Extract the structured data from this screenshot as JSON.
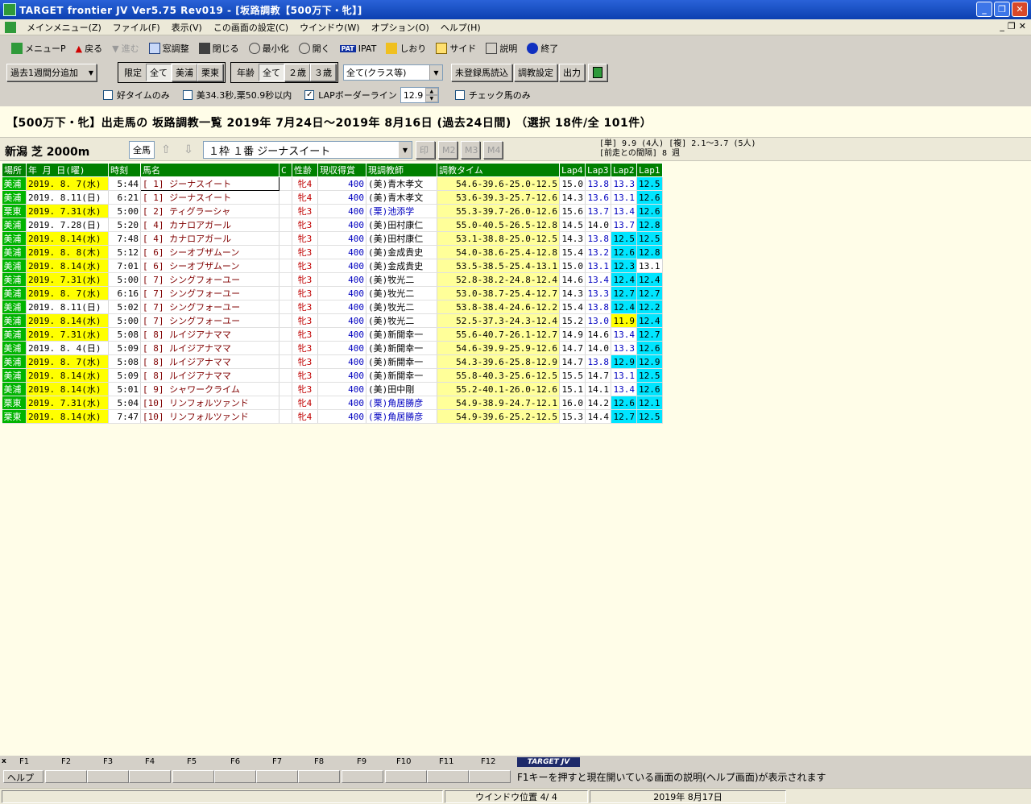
{
  "window": {
    "title": "TARGET frontier JV  Ver5.75  Rev019 - [坂路調教【500万下・牝】]"
  },
  "menu": [
    "メインメニュー(Z)",
    "ファイル(F)",
    "表示(V)",
    "この画面の設定(C)",
    "ウインドウ(W)",
    "オプション(O)",
    "ヘルプ(H)"
  ],
  "toolbar1": [
    {
      "label": "メニューP",
      "icon": "menu-icon"
    },
    {
      "label": "戻る",
      "icon": "back-arrow-icon"
    },
    {
      "label": "進む",
      "icon": "forward-arrow-icon",
      "disabled": true
    },
    {
      "label": "窓調整",
      "icon": "window-icon"
    },
    {
      "label": "閉じる",
      "icon": "close-door-icon"
    },
    {
      "label": "最小化",
      "icon": "minimize-icon"
    },
    {
      "label": "開く",
      "icon": "open-icon"
    },
    {
      "label": "IPAT",
      "icon": "pat-icon"
    },
    {
      "label": "しおり",
      "icon": "bookmark-icon"
    },
    {
      "label": "サイド",
      "icon": "side-icon"
    },
    {
      "label": "説明",
      "icon": "help-icon"
    },
    {
      "label": "終了",
      "icon": "exit-icon"
    }
  ],
  "toolbar2": {
    "add_week": "過去1週間分追加",
    "limit_label": "限定",
    "limit_opts": [
      "全て",
      "美浦",
      "栗東"
    ],
    "age_label": "年齢",
    "age_opts": [
      "全て",
      "２歳",
      "３歳"
    ],
    "class_select": "全て(クラス等)",
    "btn_unreg": "未登録馬読込",
    "btn_setting": "調教設定",
    "btn_output": "出力"
  },
  "toolbar3": {
    "good_time": "好タイムのみ",
    "time_limit": "美34.3秒,栗50.9秒以内",
    "lap_border": "LAPボーダーライン",
    "lap_value": "12.9",
    "check_only": "チェック馬のみ"
  },
  "heading": "【500万下・牝】出走馬の 坂路調教一覧  2019年 7月24日～2019年 8月16日 (過去24日間) （選択 18件/全 101件）",
  "race": {
    "name": "新潟 芝 2000m",
    "all": "全馬",
    "horse_select": "１枠  １番  ジーナスイート",
    "mark_buttons": [
      "印",
      "M2",
      "M3",
      "M4"
    ],
    "odds_line1": "[単]   9.9 (4人) [複] 2.1～3.7 (5人)",
    "odds_line2": "[前走との間隔] 8 週"
  },
  "table": {
    "headers": [
      "場所",
      "年  月 日(曜)",
      "時刻",
      "馬名",
      "C",
      "性齢",
      "現収得賞",
      "現調教師",
      "調教タイム",
      "Lap4",
      "Lap3",
      "Lap2",
      "Lap1"
    ],
    "rows": [
      {
        "place": "美浦",
        "date": "2019. 8. 7(水)",
        "date_hl": true,
        "time": "5:44",
        "horse": "[ 1]  ジーナスイート",
        "sel": true,
        "sex": "牝4",
        "prize": "400",
        "trainer": "(美)青木孝文",
        "ritto": false,
        "train": "54.6-39.6-25.0-12.5",
        "lap4": "15.0",
        "lap3": "13.8",
        "lap2": "13.3",
        "lap1": "12.5",
        "lap2c": "",
        "lap1c": "cyan",
        "lap3b": true,
        "lap2b": true
      },
      {
        "place": "美浦",
        "date": "2019. 8.11(日)",
        "date_hl": false,
        "time": "6:21",
        "horse": "[ 1]  ジーナスイート",
        "sel": false,
        "sex": "牝4",
        "prize": "400",
        "trainer": "(美)青木孝文",
        "ritto": false,
        "train": "53.6-39.3-25.7-12.6",
        "lap4": "14.3",
        "lap3": "13.6",
        "lap2": "13.1",
        "lap1": "12.6",
        "lap2c": "",
        "lap1c": "cyan",
        "lap3b": true,
        "lap2b": true
      },
      {
        "place": "栗東",
        "date": "2019. 7.31(水)",
        "date_hl": true,
        "time": "5:00",
        "horse": "[ 2]  ティグラーシャ",
        "sel": false,
        "sex": "牝3",
        "prize": "400",
        "trainer": "(栗)池添学",
        "ritto": true,
        "train": "55.3-39.7-26.0-12.6",
        "lap4": "15.6",
        "lap3": "13.7",
        "lap2": "13.4",
        "lap1": "12.6",
        "lap2c": "",
        "lap1c": "cyan",
        "lap3b": true,
        "lap2b": true
      },
      {
        "place": "美浦",
        "date": "2019. 7.28(日)",
        "date_hl": false,
        "time": "5:20",
        "horse": "[ 4]  カナロアガール",
        "sel": false,
        "sex": "牝3",
        "prize": "400",
        "trainer": "(美)田村康仁",
        "ritto": false,
        "train": "55.0-40.5-26.5-12.8",
        "lap4": "14.5",
        "lap3": "14.0",
        "lap2": "13.7",
        "lap1": "12.8",
        "lap2c": "",
        "lap1c": "cyan",
        "lap3b": false,
        "lap2b": true
      },
      {
        "place": "美浦",
        "date": "2019. 8.14(水)",
        "date_hl": true,
        "time": "7:48",
        "horse": "[ 4]  カナロアガール",
        "sel": false,
        "sex": "牝3",
        "prize": "400",
        "trainer": "(美)田村康仁",
        "ritto": false,
        "train": "53.1-38.8-25.0-12.5",
        "lap4": "14.3",
        "lap3": "13.8",
        "lap2": "12.5",
        "lap1": "12.5",
        "lap2c": "cyan",
        "lap1c": "cyan",
        "lap3b": true,
        "lap2b": false
      },
      {
        "place": "美浦",
        "date": "2019. 8. 8(木)",
        "date_hl": true,
        "time": "5:12",
        "horse": "[ 6]  シーオブザムーン",
        "sel": false,
        "sex": "牝3",
        "prize": "400",
        "trainer": "(美)金成貴史",
        "ritto": false,
        "train": "54.0-38.6-25.4-12.8",
        "lap4": "15.4",
        "lap3": "13.2",
        "lap2": "12.6",
        "lap1": "12.8",
        "lap2c": "cyan",
        "lap1c": "cyan",
        "lap3b": true,
        "lap2b": false
      },
      {
        "place": "美浦",
        "date": "2019. 8.14(水)",
        "date_hl": true,
        "time": "7:01",
        "horse": "[ 6]  シーオブザムーン",
        "sel": false,
        "sex": "牝3",
        "prize": "400",
        "trainer": "(美)金成貴史",
        "ritto": false,
        "train": "53.5-38.5-25.4-13.1",
        "lap4": "15.0",
        "lap3": "13.1",
        "lap2": "12.3",
        "lap1": "13.1",
        "lap2c": "cyan",
        "lap1c": "",
        "lap3b": true,
        "lap2b": false
      },
      {
        "place": "美浦",
        "date": "2019. 7.31(水)",
        "date_hl": true,
        "time": "5:00",
        "horse": "[ 7]  シングフォーユー",
        "sel": false,
        "sex": "牝3",
        "prize": "400",
        "trainer": "(美)牧光二",
        "ritto": false,
        "train": "52.8-38.2-24.8-12.4",
        "lap4": "14.6",
        "lap3": "13.4",
        "lap2": "12.4",
        "lap1": "12.4",
        "lap2c": "cyan",
        "lap1c": "cyan",
        "lap3b": true,
        "lap2b": false
      },
      {
        "place": "美浦",
        "date": "2019. 8. 7(水)",
        "date_hl": true,
        "time": "6:16",
        "horse": "[ 7]  シングフォーユー",
        "sel": false,
        "sex": "牝3",
        "prize": "400",
        "trainer": "(美)牧光二",
        "ritto": false,
        "train": "53.0-38.7-25.4-12.7",
        "lap4": "14.3",
        "lap3": "13.3",
        "lap2": "12.7",
        "lap1": "12.7",
        "lap2c": "cyan",
        "lap1c": "cyan",
        "lap3b": true,
        "lap2b": false
      },
      {
        "place": "美浦",
        "date": "2019. 8.11(日)",
        "date_hl": false,
        "time": "5:02",
        "horse": "[ 7]  シングフォーユー",
        "sel": false,
        "sex": "牝3",
        "prize": "400",
        "trainer": "(美)牧光二",
        "ritto": false,
        "train": "53.8-38.4-24.6-12.2",
        "lap4": "15.4",
        "lap3": "13.8",
        "lap2": "12.4",
        "lap1": "12.2",
        "lap2c": "cyan",
        "lap1c": "cyan",
        "lap3b": true,
        "lap2b": false
      },
      {
        "place": "美浦",
        "date": "2019. 8.14(水)",
        "date_hl": true,
        "time": "5:00",
        "horse": "[ 7]  シングフォーユー",
        "sel": false,
        "sex": "牝3",
        "prize": "400",
        "trainer": "(美)牧光二",
        "ritto": false,
        "train": "52.5-37.3-24.3-12.4",
        "lap4": "15.2",
        "lap3": "13.0",
        "lap2": "11.9",
        "lap1": "12.4",
        "lap2c": "yel",
        "lap1c": "cyan",
        "lap3b": true,
        "lap2b": false
      },
      {
        "place": "美浦",
        "date": "2019. 7.31(水)",
        "date_hl": true,
        "time": "5:08",
        "horse": "[ 8]  ルイジアナママ",
        "sel": false,
        "sex": "牝3",
        "prize": "400",
        "trainer": "(美)新開幸一",
        "ritto": false,
        "train": "55.6-40.7-26.1-12.7",
        "lap4": "14.9",
        "lap3": "14.6",
        "lap2": "13.4",
        "lap1": "12.7",
        "lap2c": "",
        "lap1c": "cyan",
        "lap3b": false,
        "lap2b": true
      },
      {
        "place": "美浦",
        "date": "2019. 8. 4(日)",
        "date_hl": false,
        "time": "5:09",
        "horse": "[ 8]  ルイジアナママ",
        "sel": false,
        "sex": "牝3",
        "prize": "400",
        "trainer": "(美)新開幸一",
        "ritto": false,
        "train": "54.6-39.9-25.9-12.6",
        "lap4": "14.7",
        "lap3": "14.0",
        "lap2": "13.3",
        "lap1": "12.6",
        "lap2c": "",
        "lap1c": "cyan",
        "lap3b": false,
        "lap2b": true
      },
      {
        "place": "美浦",
        "date": "2019. 8. 7(水)",
        "date_hl": true,
        "time": "5:08",
        "horse": "[ 8]  ルイジアナママ",
        "sel": false,
        "sex": "牝3",
        "prize": "400",
        "trainer": "(美)新開幸一",
        "ritto": false,
        "train": "54.3-39.6-25.8-12.9",
        "lap4": "14.7",
        "lap3": "13.8",
        "lap2": "12.9",
        "lap1": "12.9",
        "lap2c": "cyan",
        "lap1c": "cyan",
        "lap3b": true,
        "lap2b": false
      },
      {
        "place": "美浦",
        "date": "2019. 8.14(水)",
        "date_hl": true,
        "time": "5:09",
        "horse": "[ 8]  ルイジアナママ",
        "sel": false,
        "sex": "牝3",
        "prize": "400",
        "trainer": "(美)新開幸一",
        "ritto": false,
        "train": "55.8-40.3-25.6-12.5",
        "lap4": "15.5",
        "lap3": "14.7",
        "lap2": "13.1",
        "lap1": "12.5",
        "lap2c": "",
        "lap1c": "cyan",
        "lap3b": false,
        "lap2b": true
      },
      {
        "place": "美浦",
        "date": "2019. 8.14(水)",
        "date_hl": true,
        "time": "5:01",
        "horse": "[ 9]  シャワークライム",
        "sel": false,
        "sex": "牝3",
        "prize": "400",
        "trainer": "(美)田中剛",
        "ritto": false,
        "train": "55.2-40.1-26.0-12.6",
        "lap4": "15.1",
        "lap3": "14.1",
        "lap2": "13.4",
        "lap1": "12.6",
        "lap2c": "",
        "lap1c": "cyan",
        "lap3b": false,
        "lap2b": true
      },
      {
        "place": "栗東",
        "date": "2019. 7.31(水)",
        "date_hl": true,
        "time": "5:04",
        "horse": "[10]  リンフォルツァンド",
        "sel": false,
        "sex": "牝4",
        "prize": "400",
        "trainer": "(栗)角居勝彦",
        "ritto": true,
        "train": "54.9-38.9-24.7-12.1",
        "lap4": "16.0",
        "lap3": "14.2",
        "lap2": "12.6",
        "lap1": "12.1",
        "lap2c": "cyan",
        "lap1c": "cyan",
        "lap3b": false,
        "lap2b": false
      },
      {
        "place": "栗東",
        "date": "2019. 8.14(水)",
        "date_hl": true,
        "time": "7:47",
        "horse": "[10]  リンフォルツァンド",
        "sel": false,
        "sex": "牝4",
        "prize": "400",
        "trainer": "(栗)角居勝彦",
        "ritto": true,
        "train": "54.9-39.6-25.2-12.5",
        "lap4": "15.3",
        "lap3": "14.4",
        "lap2": "12.7",
        "lap1": "12.5",
        "lap2c": "cyan",
        "lap1c": "cyan",
        "lap3b": false,
        "lap2b": false
      }
    ]
  },
  "fkeys": {
    "labels": [
      "F1",
      "F2",
      "F3",
      "F4",
      "F5",
      "F6",
      "F7",
      "F8",
      "F9",
      "F10",
      "F11",
      "F12"
    ],
    "help_btn": "ヘルプ",
    "logo": "TARGET JV",
    "hint": "F1キーを押すと現在開いている画面の説明(ヘルプ画面)が表示されます"
  },
  "status": {
    "window_pos": "ウインドウ位置 4/ 4",
    "date": "2019年 8月17日"
  },
  "colors": {
    "title_bar": "#0b3fb0",
    "header_green": "#008000",
    "place_green": "#00b400",
    "date_yellow": "#ffff00",
    "lap_cyan": "#00e5ff",
    "content_bg": "#fffde8"
  }
}
